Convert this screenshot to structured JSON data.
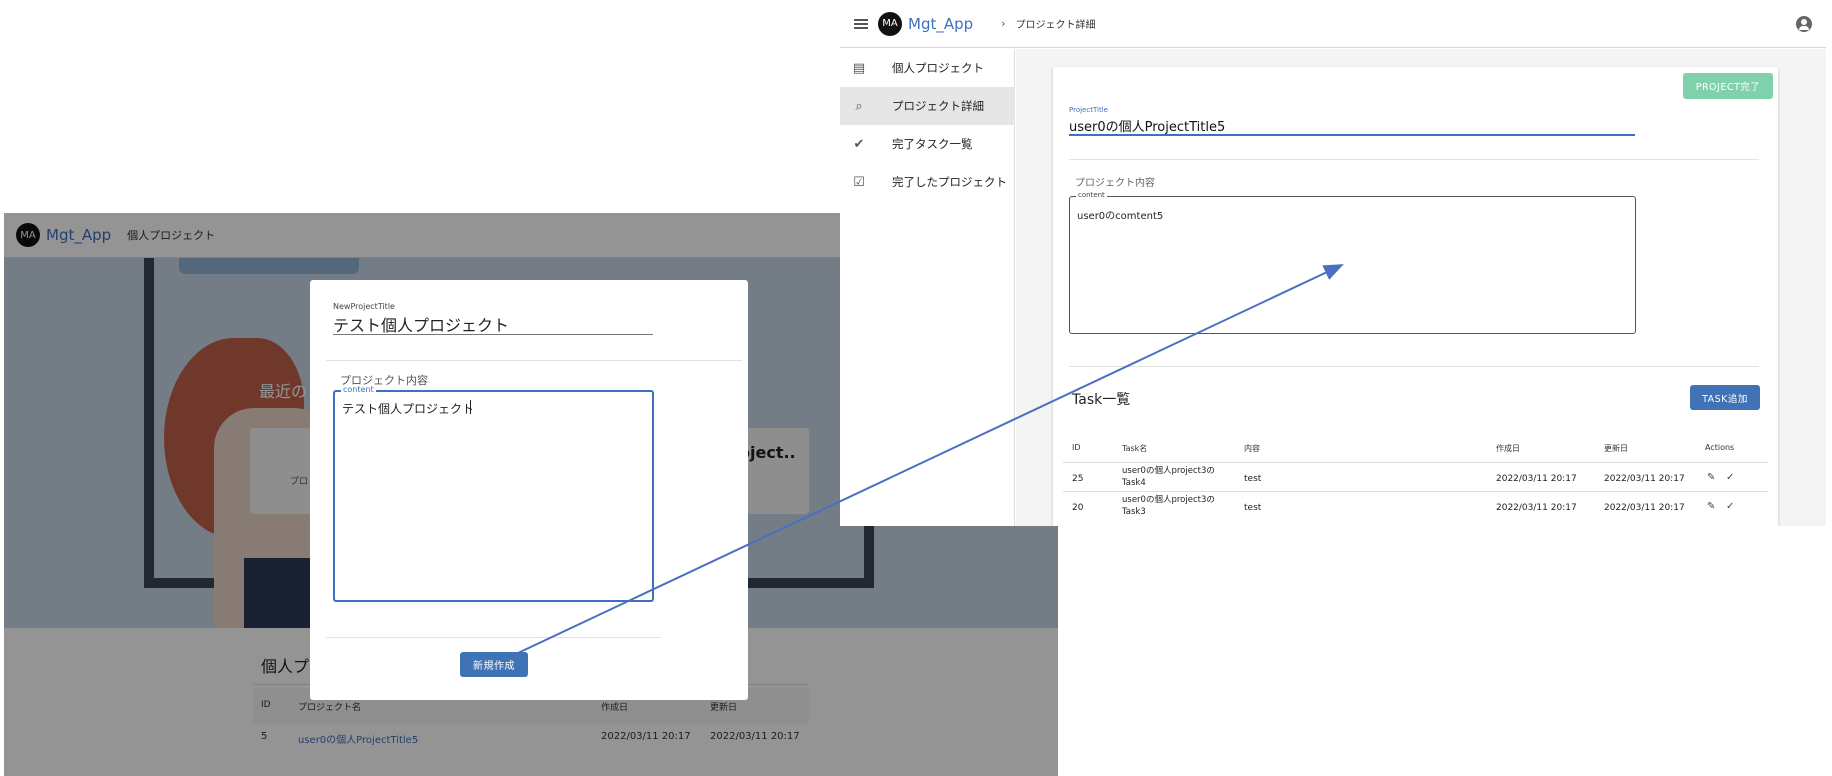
{
  "left": {
    "appbar": {
      "avatar": "MA",
      "app_name": "Mgt_App",
      "breadcrumb": "個人プロジェクト"
    },
    "hero": {
      "text": "最近の",
      "card_right_text": "oject..",
      "card_left_text": "プロ"
    },
    "list": {
      "title": "個人プロ",
      "columns": [
        "ID",
        "プロジェクト名",
        "作成日",
        "更新日"
      ],
      "rows": [
        {
          "id": "5",
          "name": "user0の個人ProjectTitle5",
          "created": "2022/03/11 20:17",
          "updated": "2022/03/11 20:17"
        }
      ]
    },
    "dialog": {
      "title_label": "NewProjectTitle",
      "title_value": "テスト個人プロジェクト",
      "section_label": "プロジェクト内容",
      "content_label": "content",
      "content_value": "テスト個人プロジェクト",
      "submit_label": "新規作成"
    }
  },
  "right": {
    "appbar": {
      "avatar": "MA",
      "app_name": "Mgt_App",
      "breadcrumb": "プロジェクト詳細"
    },
    "sidebar": {
      "items": [
        {
          "label": "個人プロジェクト",
          "icon": "document-icon",
          "active": false
        },
        {
          "label": "プロジェクト詳細",
          "icon": "file-search-icon",
          "active": true
        },
        {
          "label": "完了タスク一覧",
          "icon": "check-circle-icon",
          "active": false
        },
        {
          "label": "完了したプロジェクト",
          "icon": "calendar-check-icon",
          "active": false
        }
      ]
    },
    "detail": {
      "complete_button": "PROJECT完了",
      "title_label": "ProjectTitle",
      "title_value": "user0の個人ProjectTitle5",
      "section_label": "プロジェクト内容",
      "content_label": "content",
      "content_value": "user0のcomtent5"
    },
    "tasks": {
      "heading": "Task一覧",
      "add_button": "TASK追加",
      "columns": [
        "ID",
        "Task名",
        "内容",
        "作成日",
        "更新日",
        "Actions"
      ],
      "rows": [
        {
          "id": "25",
          "name_line1": "user0の個人project3の",
          "name_line2": "Task4",
          "content": "test",
          "created": "2022/03/11 20:17",
          "updated": "2022/03/11 20:17"
        },
        {
          "id": "20",
          "name_line1": "user0の個人project3の",
          "name_line2": "Task3",
          "content": "test",
          "created": "2022/03/11 20:17",
          "updated": "2022/03/11 20:17"
        }
      ]
    }
  },
  "colors": {
    "accent": "#3f6fc0",
    "button_blue": "#3f73b5",
    "button_green": "#7fd1ab",
    "arrow": "#4a6fc4"
  }
}
